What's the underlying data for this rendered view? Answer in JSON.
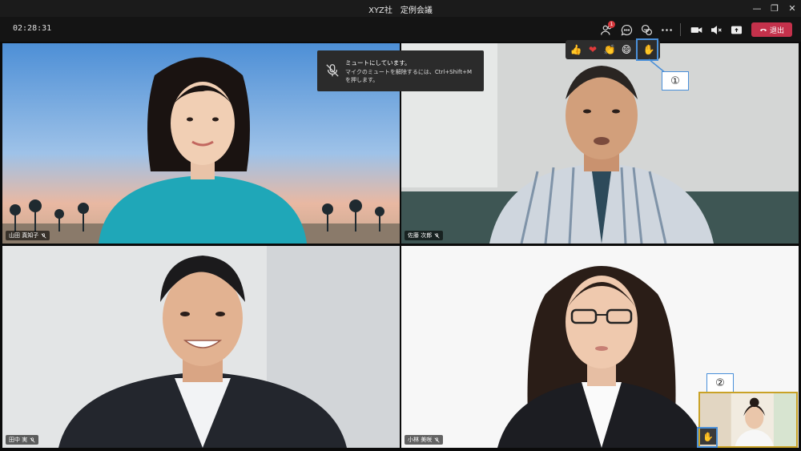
{
  "window": {
    "title": "XYZ社　定例会議",
    "min_icon": "minimize-icon",
    "restore_icon": "restore-icon",
    "close_icon": "close-icon"
  },
  "toolbar": {
    "timer": "02:28:31",
    "participants_badge": "1",
    "leave_label": "退出",
    "icons": [
      "participants-icon",
      "chat-icon",
      "reactions-icon",
      "more-icon",
      "camera-icon",
      "speaker-mute-icon",
      "share-icon",
      "phone-hangup-icon"
    ]
  },
  "mute_toast": {
    "title": "ミュートにしています。",
    "body": "マイクのミュートを解除するには、Ctrl+Shift+M を押します。"
  },
  "reactions": [
    "👍",
    "❤",
    "👏",
    "😄",
    "✋"
  ],
  "callouts": {
    "one": "①",
    "two": "②"
  },
  "participants": [
    {
      "name": "山田 真知子"
    },
    {
      "name": "佐藤 次郎"
    },
    {
      "name": "田中 実"
    },
    {
      "name": "小林 美咲"
    }
  ],
  "self_hand": "✋",
  "colors": {
    "leave": "#c4314b",
    "highlight": "#4a90d9",
    "badge": "#d7383d"
  }
}
